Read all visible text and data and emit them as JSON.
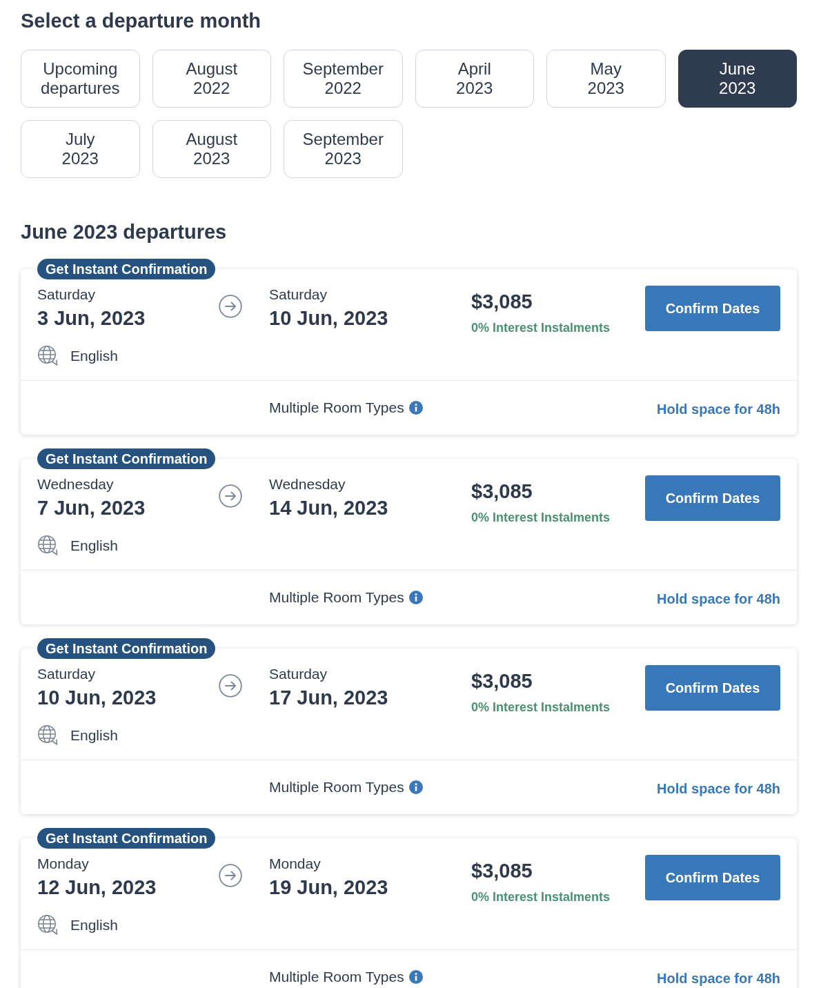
{
  "title": "Select a departure month",
  "months": [
    {
      "lines": [
        "Upcoming",
        "departures"
      ],
      "selected": false
    },
    {
      "lines": [
        "August",
        "2022"
      ],
      "selected": false
    },
    {
      "lines": [
        "September",
        "2022"
      ],
      "selected": false
    },
    {
      "lines": [
        "April",
        "2023"
      ],
      "selected": false
    },
    {
      "lines": [
        "May",
        "2023"
      ],
      "selected": false
    },
    {
      "lines": [
        "June",
        "2023"
      ],
      "selected": true
    },
    {
      "lines": [
        "July",
        "2023"
      ],
      "selected": false
    },
    {
      "lines": [
        "August",
        "2023"
      ],
      "selected": false
    },
    {
      "lines": [
        "September",
        "2023"
      ],
      "selected": false
    }
  ],
  "departures_title": "June 2023 departures",
  "departures": [
    {
      "badge": "Get Instant Confirmation",
      "start": {
        "weekday": "Saturday",
        "date": "3 Jun, 2023"
      },
      "end": {
        "weekday": "Saturday",
        "date": "10 Jun, 2023"
      },
      "language": "English",
      "price": "$3,085",
      "instalments": "0% Interest Instalments",
      "action": "Confirm Dates",
      "room_types": "Multiple Room Types",
      "hold_link": "Hold space for 48h"
    },
    {
      "badge": "Get Instant Confirmation",
      "start": {
        "weekday": "Wednesday",
        "date": "7 Jun, 2023"
      },
      "end": {
        "weekday": "Wednesday",
        "date": "14 Jun, 2023"
      },
      "language": "English",
      "price": "$3,085",
      "instalments": "0% Interest Instalments",
      "action": "Confirm Dates",
      "room_types": "Multiple Room Types",
      "hold_link": "Hold space for 48h"
    },
    {
      "badge": "Get Instant Confirmation",
      "start": {
        "weekday": "Saturday",
        "date": "10 Jun, 2023"
      },
      "end": {
        "weekday": "Saturday",
        "date": "17 Jun, 2023"
      },
      "language": "English",
      "price": "$3,085",
      "instalments": "0% Interest Instalments",
      "action": "Confirm Dates",
      "room_types": "Multiple Room Types",
      "hold_link": "Hold space for 48h"
    },
    {
      "badge": "Get Instant Confirmation",
      "start": {
        "weekday": "Monday",
        "date": "12 Jun, 2023"
      },
      "end": {
        "weekday": "Monday",
        "date": "19 Jun, 2023"
      },
      "language": "English",
      "price": "$3,085",
      "instalments": "0% Interest Instalments",
      "action": "Confirm Dates",
      "room_types": "Multiple Room Types",
      "hold_link": "Hold space for 48h"
    }
  ]
}
